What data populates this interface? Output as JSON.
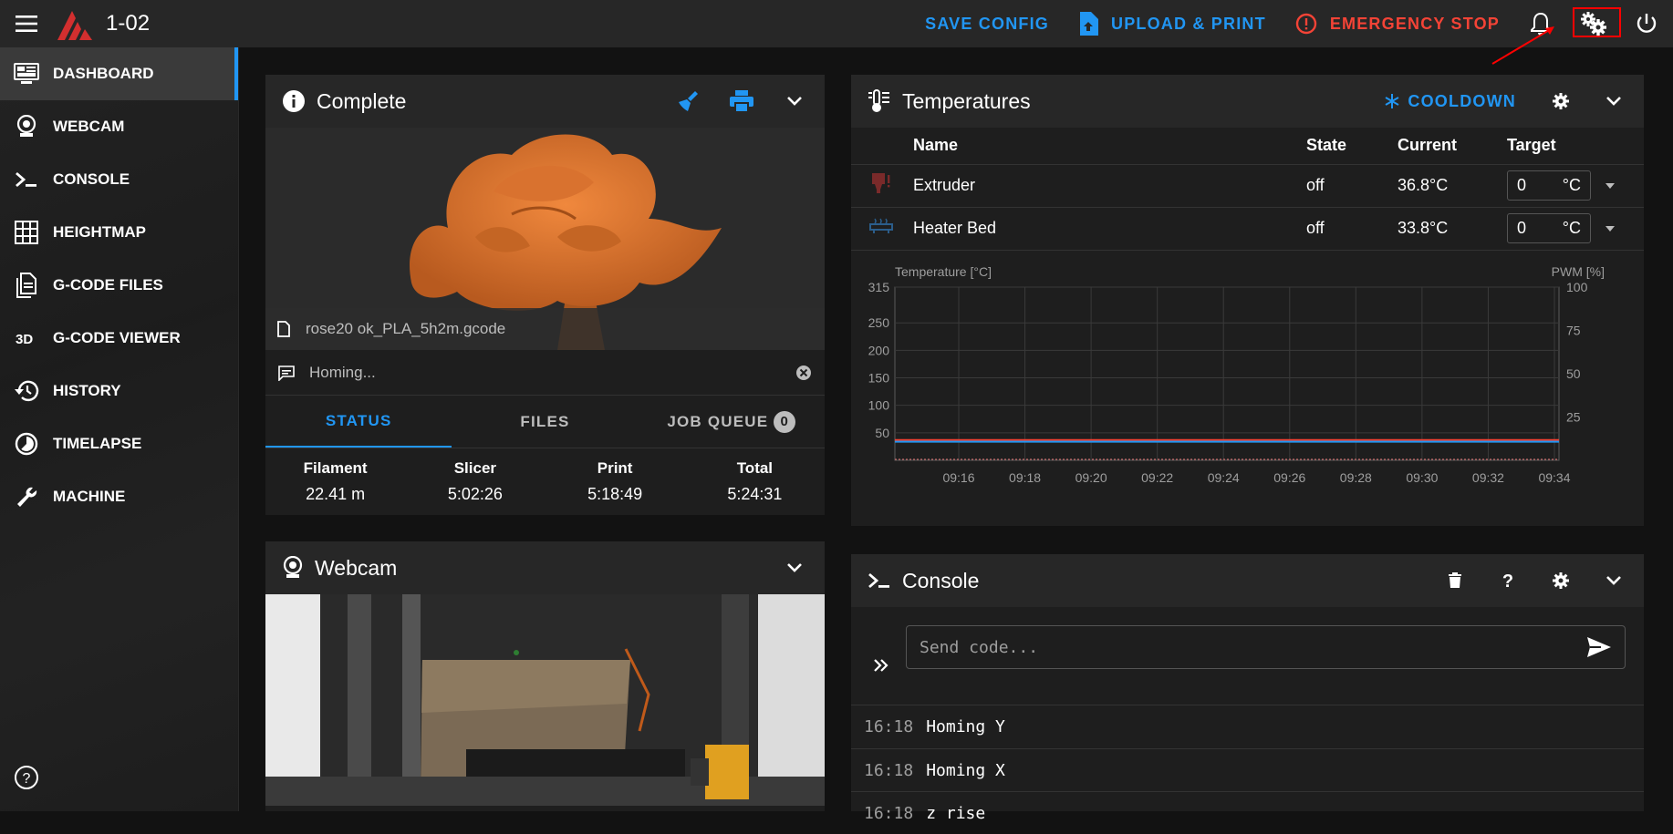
{
  "topbar": {
    "printer_name": "1-02",
    "save_config": "SAVE CONFIG",
    "upload_print": "UPLOAD & PRINT",
    "emergency_stop": "EMERGENCY STOP"
  },
  "sidebar": {
    "items": [
      {
        "label": "DASHBOARD",
        "icon": "monitor-dashboard-icon",
        "active": true
      },
      {
        "label": "WEBCAM",
        "icon": "webcam-icon"
      },
      {
        "label": "CONSOLE",
        "icon": "console-icon"
      },
      {
        "label": "HEIGHTMAP",
        "icon": "grid-icon"
      },
      {
        "label": "G-CODE FILES",
        "icon": "file-document-icon"
      },
      {
        "label": "G-CODE VIEWER",
        "icon": "3d-icon"
      },
      {
        "label": "HISTORY",
        "icon": "history-icon"
      },
      {
        "label": "TIMELAPSE",
        "icon": "timelapse-icon"
      },
      {
        "label": "MACHINE",
        "icon": "wrench-icon"
      }
    ]
  },
  "status_panel": {
    "title": "Complete",
    "filename": "rose20 ok_PLA_5h2m.gcode",
    "message": "Homing...",
    "tabs": [
      "STATUS",
      "FILES",
      "JOB QUEUE"
    ],
    "job_queue_count": "0",
    "stats": [
      {
        "label": "Filament",
        "value": "22.41 m"
      },
      {
        "label": "Slicer",
        "value": "5:02:26"
      },
      {
        "label": "Print",
        "value": "5:18:49"
      },
      {
        "label": "Total",
        "value": "5:24:31"
      }
    ]
  },
  "webcam_panel": {
    "title": "Webcam"
  },
  "temperatures_panel": {
    "title": "Temperatures",
    "cooldown": "COOLDOWN",
    "columns": [
      "Name",
      "State",
      "Current",
      "Target"
    ],
    "rows": [
      {
        "name": "Extruder",
        "state": "off",
        "current": "36.8°C",
        "target": "0",
        "unit": "°C"
      },
      {
        "name": "Heater Bed",
        "state": "off",
        "current": "33.8°C",
        "target": "0",
        "unit": "°C"
      }
    ]
  },
  "chart_data": {
    "type": "line",
    "ylabel": "Temperature [°C]",
    "y2label": "PWM [%]",
    "ylim": [
      0,
      315
    ],
    "y2lim": [
      0,
      100
    ],
    "yticks": [
      50,
      100,
      150,
      200,
      250,
      315
    ],
    "y2ticks": [
      25,
      50,
      75,
      100
    ],
    "x": [
      "09:16",
      "09:18",
      "09:20",
      "09:22",
      "09:24",
      "09:26",
      "09:28",
      "09:30",
      "09:32",
      "09:34"
    ],
    "series": [
      {
        "values": [
          36.8,
          36.8,
          36.8,
          36.8,
          36.8,
          36.8,
          36.8,
          36.8,
          36.8,
          36.8
        ],
        "color": "#f44336"
      },
      {
        "values": [
          33.8,
          33.8,
          33.8,
          33.8,
          33.8,
          33.8,
          33.8,
          33.8,
          33.8,
          33.8
        ],
        "color": "#2196f3"
      }
    ],
    "grid": true
  },
  "console_panel": {
    "title": "Console",
    "placeholder": "Send code...",
    "lines": [
      {
        "time": "16:18",
        "text": "Homing Y"
      },
      {
        "time": "16:18",
        "text": "Homing X"
      },
      {
        "time": "16:18",
        "text": "z rise"
      }
    ]
  },
  "colors": {
    "accent": "#2196f3",
    "danger": "#f44336",
    "highlight": "#ff0000"
  }
}
